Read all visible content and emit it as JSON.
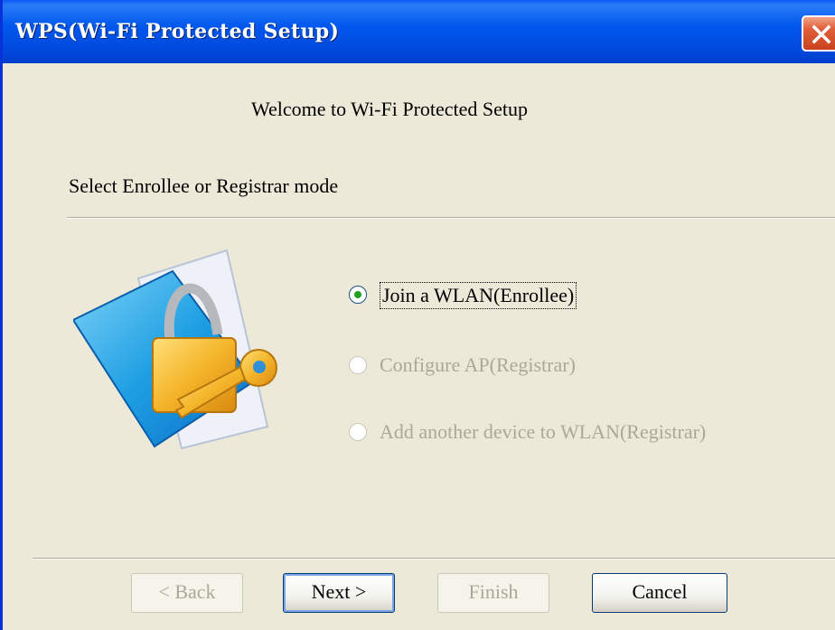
{
  "window": {
    "title": "WPS(Wi-Fi Protected Setup)",
    "close_icon": "close-icon"
  },
  "main": {
    "welcome": "Welcome to Wi-Fi Protected Setup",
    "subtitle": "Select Enrollee or Registrar mode",
    "illustration_icon": "folder-lock-key-icon",
    "options": [
      {
        "label": "Join a WLAN(Enrollee)",
        "checked": true,
        "enabled": true
      },
      {
        "label": "Configure AP(Registrar)",
        "checked": false,
        "enabled": false
      },
      {
        "label": "Add another device to WLAN(Registrar)",
        "checked": false,
        "enabled": false
      }
    ]
  },
  "buttons": {
    "back": "< Back",
    "next": "Next >",
    "finish": "Finish",
    "cancel": "Cancel"
  },
  "colors": {
    "titlebar": "#0058EE",
    "dialog_bg": "#ECE9D8",
    "close": "#E0603A",
    "radio_dot": "#21A121",
    "disabled_text": "#ACA899"
  }
}
